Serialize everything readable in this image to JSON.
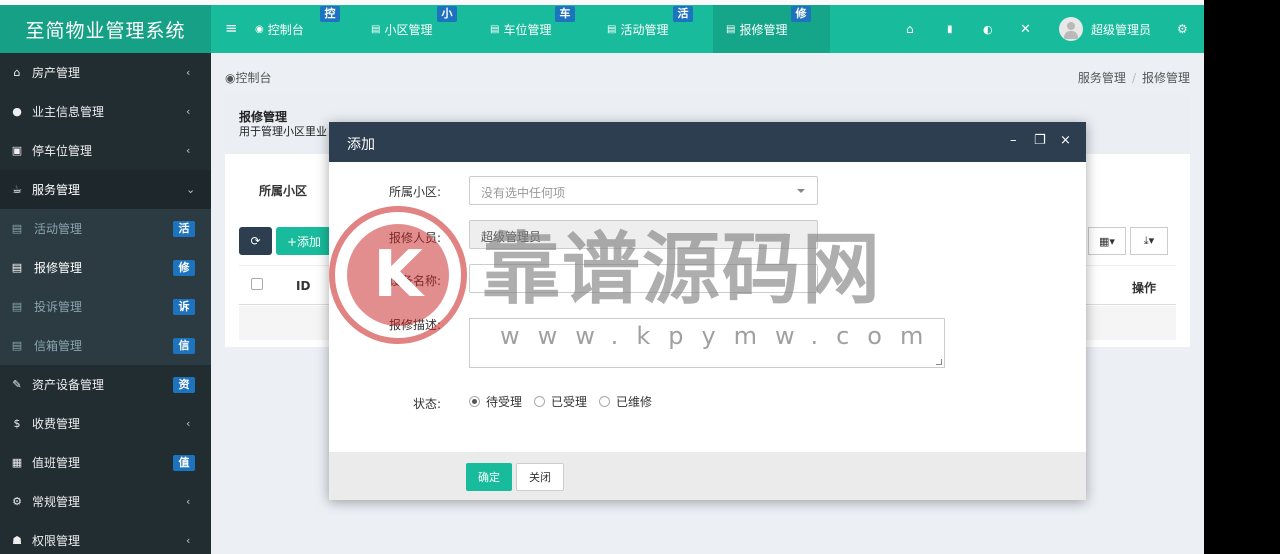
{
  "app": {
    "logo_text": "至简物业管理系统"
  },
  "header": {
    "menu_icon": "hamburger-icon",
    "tabs": [
      {
        "label": "控制台",
        "badge": "控",
        "icon": "dashboard-icon"
      },
      {
        "label": "小区管理",
        "badge": "小",
        "icon": "list-icon"
      },
      {
        "label": "车位管理",
        "badge": "车",
        "icon": "list-icon"
      },
      {
        "label": "活动管理",
        "badge": "活",
        "icon": "list-icon"
      },
      {
        "label": "报修管理",
        "badge": "修",
        "icon": "list-icon"
      }
    ],
    "user_name": "超级管理员",
    "right_icons": [
      "home-icon",
      "trash-icon",
      "language-icon",
      "fullscreen-icon",
      "gears-icon"
    ]
  },
  "sidebar": {
    "items": [
      {
        "label": "房产管理",
        "icon": "home-icon",
        "arrow": "‹"
      },
      {
        "label": "业主信息管理",
        "icon": "user-icon",
        "arrow": "‹"
      },
      {
        "label": "停车位管理",
        "icon": "parking-icon",
        "arrow": "‹"
      },
      {
        "label": "服务管理",
        "icon": "service-icon",
        "arrow": "⌄"
      },
      {
        "label": "活动管理",
        "icon": "list-icon",
        "badge": "活"
      },
      {
        "label": "报修管理",
        "icon": "list-icon",
        "badge": "修"
      },
      {
        "label": "投诉管理",
        "icon": "list-icon",
        "badge": "诉"
      },
      {
        "label": "信箱管理",
        "icon": "list-icon",
        "badge": "信"
      },
      {
        "label": "资产设备管理",
        "icon": "wrench-icon",
        "badge": "资"
      },
      {
        "label": "收费管理",
        "icon": "dollar-icon",
        "arrow": "‹"
      },
      {
        "label": "值班管理",
        "icon": "calendar-icon",
        "badge": "值"
      },
      {
        "label": "常规管理",
        "icon": "gears-icon",
        "arrow": "‹"
      },
      {
        "label": "权限管理",
        "icon": "group-icon",
        "arrow": "‹"
      }
    ]
  },
  "breadcrumb": {
    "left": "控制台",
    "right_1": "服务管理",
    "separator": "/",
    "right_2": "报修管理"
  },
  "panel": {
    "title": "报修管理",
    "description": "用于管理小区里业",
    "filter_label": "所属小区",
    "add_button": "+添加",
    "table_headers": {
      "id": "ID",
      "operation": "操作"
    }
  },
  "modal": {
    "title": "添加",
    "community_label": "所属小区:",
    "community_placeholder": "没有选中任何项",
    "reporter_label": "报修人员:",
    "reporter_value": "超级管理员",
    "device_label": "设备名称:",
    "description_label": "报修描述:",
    "status_label": "状态:",
    "status_options": [
      "待受理",
      "已受理",
      "已维修"
    ],
    "status_selected": "待受理",
    "ok_button": "确定",
    "close_button": "关闭"
  },
  "watermark": {
    "logo_letter": "K",
    "text": "靠谱源码网",
    "url": "www.kpymw.com"
  },
  "colors": {
    "brand": "#18bc9c",
    "logo_bg": "#16a085",
    "sidebar": "#222d32",
    "badge": "#1e73be",
    "modal_head": "#2c3e50"
  }
}
